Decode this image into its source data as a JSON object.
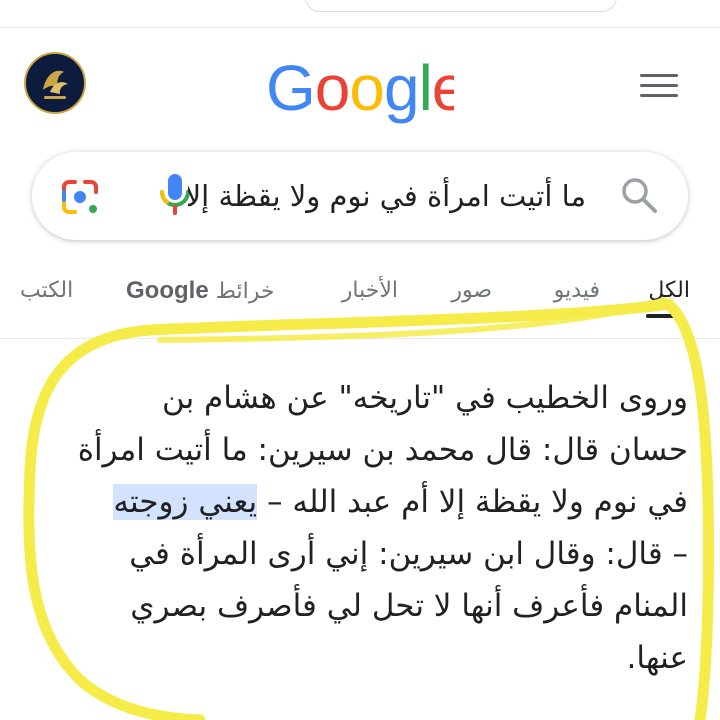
{
  "header": {
    "logo_letters": [
      "G",
      "o",
      "o",
      "g",
      "l",
      "e"
    ],
    "logo_colors": [
      "#4285f4",
      "#ea4335",
      "#fbbc05",
      "#4285f4",
      "#34a853",
      "#ea4335"
    ]
  },
  "search": {
    "query": "ما أتيت امرأة في نوم ولا يقظة إلا"
  },
  "tabs": [
    {
      "label": "الكل",
      "active": true
    },
    {
      "label": "فيديو",
      "active": false
    },
    {
      "label": "صور",
      "active": false
    },
    {
      "label": "الأخبار",
      "active": false
    },
    {
      "label": "خرائط",
      "brand": "Google",
      "active": false
    },
    {
      "label": "الكتب",
      "active": false
    }
  ],
  "article": {
    "line1": "وروى الخطيب في \"تاريخه\" عن هشام بن",
    "line2": "حسان قال: قال محمد بن سيرين: ما أتيت امرأة",
    "line3_plain": "في نوم ولا يقظة إلا أم عبد الله – ",
    "line3_highlight": "يعني زوجته",
    "line4": "– قال: وقال ابن سيرين: إني أرى المرأة في",
    "line5": "المنام فأعرف أنها لا تحل لي فأصرف بصري",
    "line6": "عنها."
  },
  "colors": {
    "annotation": "#f5ec4a",
    "selection": "#d3e3fd",
    "active_tab": "#202124",
    "inactive_tab": "#70757a"
  }
}
